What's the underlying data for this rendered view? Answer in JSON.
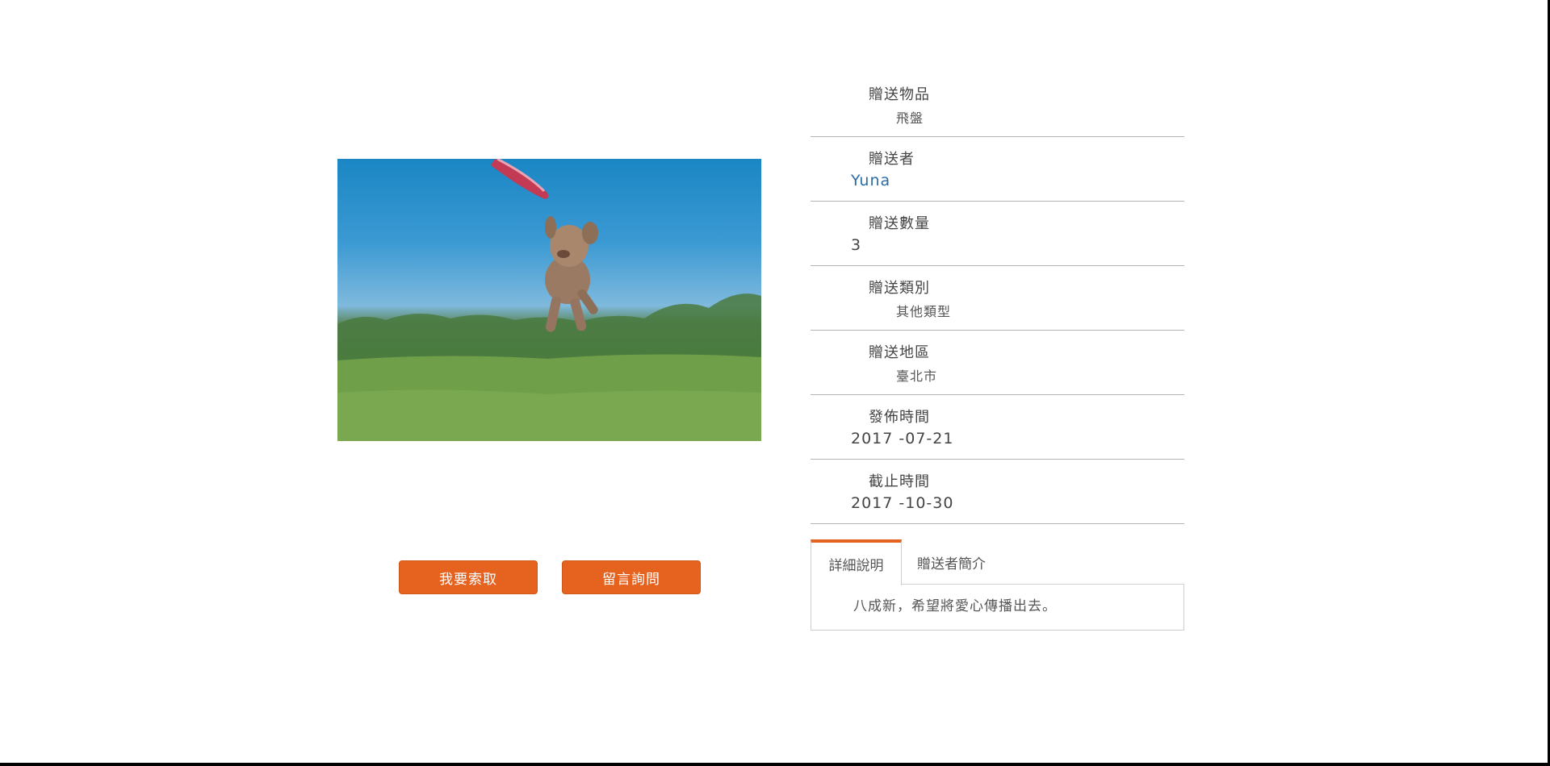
{
  "actions": {
    "request_label": "我要索取",
    "inquire_label": "留言詢問"
  },
  "details": {
    "item": {
      "label": "贈送物品",
      "value": "飛盤"
    },
    "giver": {
      "label": "贈送者",
      "value": "Yuna"
    },
    "quantity": {
      "label": "贈送數量",
      "value": "3"
    },
    "category": {
      "label": "贈送類別",
      "value": "其他類型"
    },
    "region": {
      "label": "贈送地區",
      "value": "臺北市"
    },
    "published": {
      "label": "發佈時間",
      "value": "2017 -07-21"
    },
    "deadline": {
      "label": "截止時間",
      "value": "2017 -10-30"
    }
  },
  "tabs": [
    {
      "label": "詳細說明"
    },
    {
      "label": "贈送者簡介"
    }
  ],
  "description": "八成新，希望將愛心傳播出去。",
  "colors": {
    "accent": "#e5621f",
    "link": "#2b6ca3"
  }
}
